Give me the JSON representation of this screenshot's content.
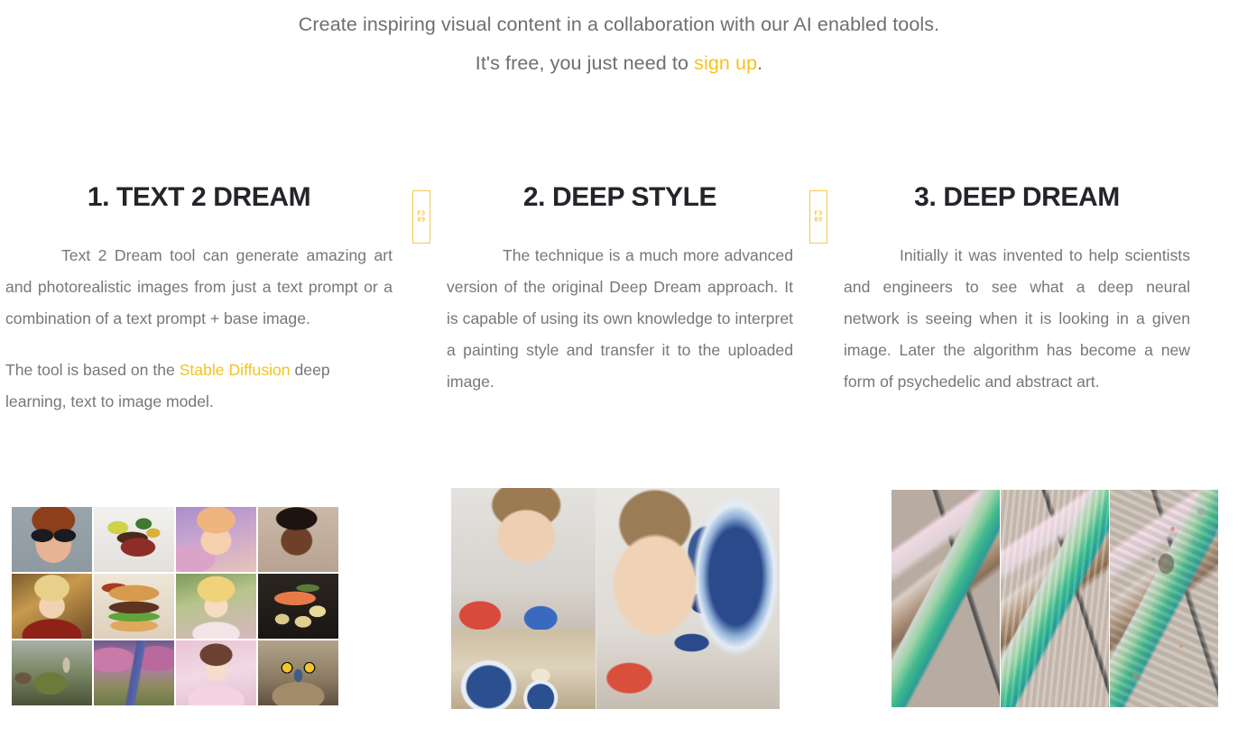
{
  "intro": {
    "line1": "Create inspiring visual content in a collaboration with our AI enabled tools.",
    "line2_prefix": "It's free, you just need to ",
    "line2_link": "sign up",
    "line2_suffix": "."
  },
  "separator": {
    "missing_glyph_codepoint_top": "F3",
    "missing_glyph_codepoint_bottom": "09"
  },
  "columns": [
    {
      "heading": "1. TEXT 2 DREAM",
      "paragraph1": "Text 2 Dream tool can generate amazing art and photorealistic images from just a text prompt or a combination of a text prompt + base image.",
      "paragraph2_prefix": "The tool is based on the ",
      "paragraph2_link": "Stable Diffusion",
      "paragraph2_suffix": " deep learning, text to image model.",
      "image_alt": "Grid of twelve AI generated images: portraits, food and landscapes"
    },
    {
      "heading": "2. DEEP STYLE",
      "paragraph1": "The technique is a much more advanced version of the original Deep Dream approach. It is capable of using its own knowledge to interpret a painting style and transfer it to the uploaded image.",
      "image_alt": "Portrait of a girl plus The Great Wave painting style, and the resulting stylized image"
    },
    {
      "heading": "3. DEEP DREAM",
      "paragraph1": "Initially it was invented to help scientists and engineers to see what a deep neural network is seeing when it is looking in a given image. Later the algorithm has become a new form of psychedelic and abstract art.",
      "image_alt": "Hummingbird shown in three progressive deep dream stages"
    }
  ],
  "colors": {
    "accent": "#f5c220",
    "heading": "#24242a",
    "body_text": "#777777",
    "intro_text": "#6f6f6f",
    "background": "#ffffff",
    "separator_border": "#f2c94c"
  }
}
